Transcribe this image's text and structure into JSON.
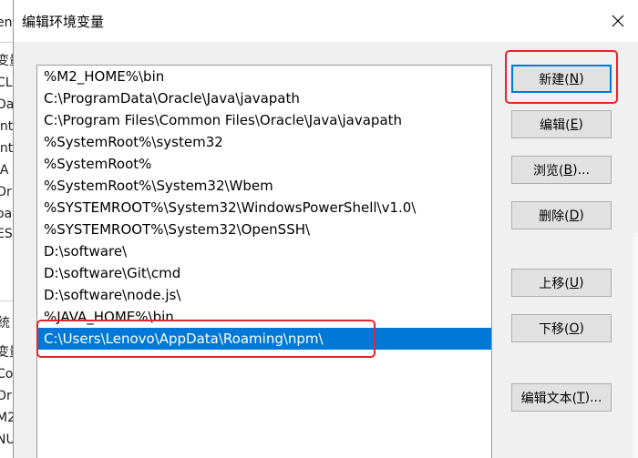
{
  "dialog": {
    "title": "编辑环境变量"
  },
  "background_window": {
    "fragments": [
      "eno",
      "变量",
      "CL",
      "Da",
      "int",
      "int",
      "JA",
      "Or",
      "oa",
      "ES",
      "变量",
      "Co",
      "Or",
      "M2",
      "NU"
    ],
    "section_title": "统"
  },
  "path_list": {
    "items": [
      "%M2_HOME%\\bin",
      "C:\\ProgramData\\Oracle\\Java\\javapath",
      "C:\\Program Files\\Common Files\\Oracle\\Java\\javapath",
      "%SystemRoot%\\system32",
      "%SystemRoot%",
      "%SystemRoot%\\System32\\Wbem",
      "%SYSTEMROOT%\\System32\\WindowsPowerShell\\v1.0\\",
      "%SYSTEMROOT%\\System32\\OpenSSH\\",
      "D:\\software\\",
      "D:\\software\\Git\\cmd",
      "D:\\software\\node.js\\",
      "%JAVA_HOME%\\bin",
      "C:\\Users\\Lenovo\\AppData\\Roaming\\npm\\"
    ],
    "selected_index": 12
  },
  "buttons": {
    "new": {
      "label": "新建(",
      "key": "N",
      "end": ")"
    },
    "edit": {
      "label": "编辑(",
      "key": "E",
      "end": ")"
    },
    "browse": {
      "label": "浏览(",
      "key": "B",
      "end": ")..."
    },
    "delete": {
      "label": "删除(",
      "key": "D",
      "end": ")"
    },
    "move_up": {
      "label": "上移(",
      "key": "U",
      "end": ")"
    },
    "move_down": {
      "label": "下移(",
      "key": "O",
      "end": ")"
    },
    "edit_text": {
      "label": "编辑文本(",
      "key": "T",
      "end": ")..."
    }
  },
  "colors": {
    "selection": "#0078d7",
    "highlight": "#e8232a",
    "button_face": "#e1e1e1"
  },
  "icons": [
    "close-icon"
  ]
}
